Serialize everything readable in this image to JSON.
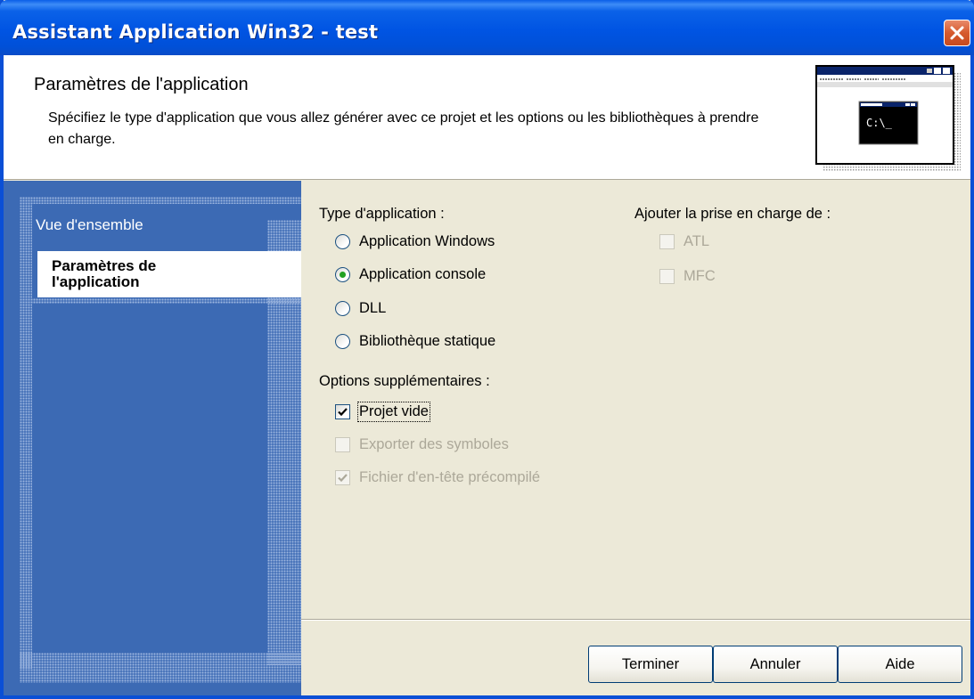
{
  "window": {
    "title": "Assistant Application Win32 - test"
  },
  "header": {
    "title": "Paramètres de l'application",
    "description": "Spécifiez le type d'application que vous allez générer avec ce projet et les options ou les bibliothèques à prendre en charge.",
    "image_text": "C:\\_"
  },
  "sidebar": {
    "items": [
      {
        "label": "Vue d'ensemble",
        "active": false
      },
      {
        "label_line1": "Paramètres de",
        "label_line2": "l'application",
        "active": true
      }
    ]
  },
  "app_type": {
    "label": "Type d'application :",
    "options": [
      {
        "label": "Application Windows",
        "checked": false
      },
      {
        "label": "Application console",
        "checked": true
      },
      {
        "label": "DLL",
        "checked": false
      },
      {
        "label": "Bibliothèque statique",
        "checked": false
      }
    ]
  },
  "extra_options": {
    "label": "Options supplémentaires :",
    "options": [
      {
        "label": "Projet vide",
        "checked": true,
        "enabled": true
      },
      {
        "label": "Exporter des symboles",
        "checked": false,
        "enabled": false
      },
      {
        "label": "Fichier d'en-tête précompilé",
        "checked": true,
        "enabled": false
      }
    ]
  },
  "support": {
    "label": "Ajouter la prise en charge de :",
    "options": [
      {
        "label": "ATL",
        "checked": false,
        "enabled": false
      },
      {
        "label": "MFC",
        "checked": false,
        "enabled": false
      }
    ]
  },
  "buttons": {
    "finish": "Terminer",
    "cancel": "Annuler",
    "help": "Aide"
  },
  "colors": {
    "titlebar": "#0054e3",
    "sidebar": "#3c6ab4",
    "dialog_bg": "#ece9d8",
    "disabled_text": "#aca899"
  }
}
